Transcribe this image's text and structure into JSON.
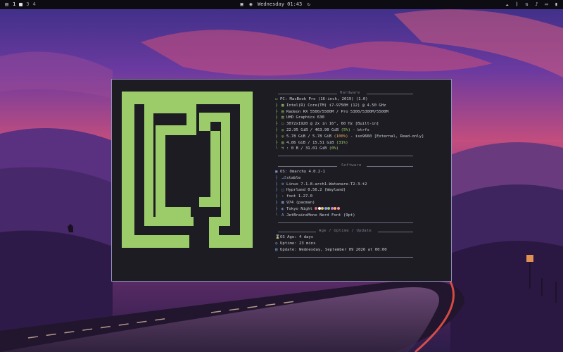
{
  "topbar": {
    "workspaces": [
      "1",
      "2",
      "3",
      "4"
    ],
    "clock": "Wednesday 01:43",
    "tray_icons": [
      "cloud-icon",
      "bluetooth-icon",
      "network-icon",
      "speaker-icon",
      "monitor-icon",
      "battery-icon"
    ]
  },
  "hardware": {
    "title": "Hardware",
    "rows": [
      {
        "key": "PC",
        "value": "MacBook Pro (16-inch, 2019) (1.0)"
      },
      {
        "key": "",
        "value": "Intel(R) Core(TM) i7-9750H (12) @ 4.50 GHz"
      },
      {
        "key": "",
        "value": "Radeon RX 5500/5500M / Pro 5300/5300M/5500M"
      },
      {
        "key": "",
        "value": "UHD Graphics 630"
      },
      {
        "key": "",
        "value": "3072x1920 @ 2x in 16\", 60 Hz [Built-in]"
      },
      {
        "key": "",
        "value": "22.95 GiB / 463.90 GiB",
        "pct": "(5%)",
        "tail": " - btrfs"
      },
      {
        "key": "",
        "value": "5.78 GiB / 5.78 GiB",
        "pct": "(100%)",
        "tail": " - iso9660 [External, Read-only]"
      },
      {
        "key": "",
        "value": "4.86 GiB / 15.51 GiB",
        "pct": "(31%)",
        "tail": ""
      },
      {
        "key": "",
        "value": ": 0 B / 31.01 GiB",
        "pct": "(0%)",
        "tail": ""
      }
    ]
  },
  "software": {
    "title": "Software",
    "rows": [
      {
        "key": "OS",
        "value": "Omarchy 4.0.2-1"
      },
      {
        "key": "",
        "value": "stable"
      },
      {
        "key": "",
        "value": "Linux 7.1.8-arch1-Watanare-T2-3-t2"
      },
      {
        "key": "",
        "value": "Hyprland 0.56.2 (Wayland)"
      },
      {
        "key": "",
        "value": "foot 1.27.0"
      },
      {
        "key": "",
        "value": "974 (pacman)"
      },
      {
        "key": "",
        "value": "Tokyo Night"
      },
      {
        "key": "",
        "value": "JetBrainsMono Nerd Font (9pt)"
      }
    ],
    "palette": [
      "#e06c75",
      "#ffffff",
      "#f0c060",
      "#7aa2f7",
      "#a0c070",
      "#c678dd",
      "#ffb070",
      "#ff8fa0"
    ]
  },
  "uptime": {
    "title": "Age / Uptime / Update",
    "rows": [
      {
        "key": "OS Age",
        "value": ": 4 days"
      },
      {
        "key": "Uptime",
        "value": ": 23 mins"
      },
      {
        "key": "Update",
        "value": ": Wednesday, September 09 2026 at 00:00"
      }
    ]
  },
  "colors": {
    "terminal_bg": "#1c1c22",
    "logo_green": "#9ccc6a",
    "frame_border": "#8f8fb8",
    "accent_blue": "#7ea4e0"
  }
}
